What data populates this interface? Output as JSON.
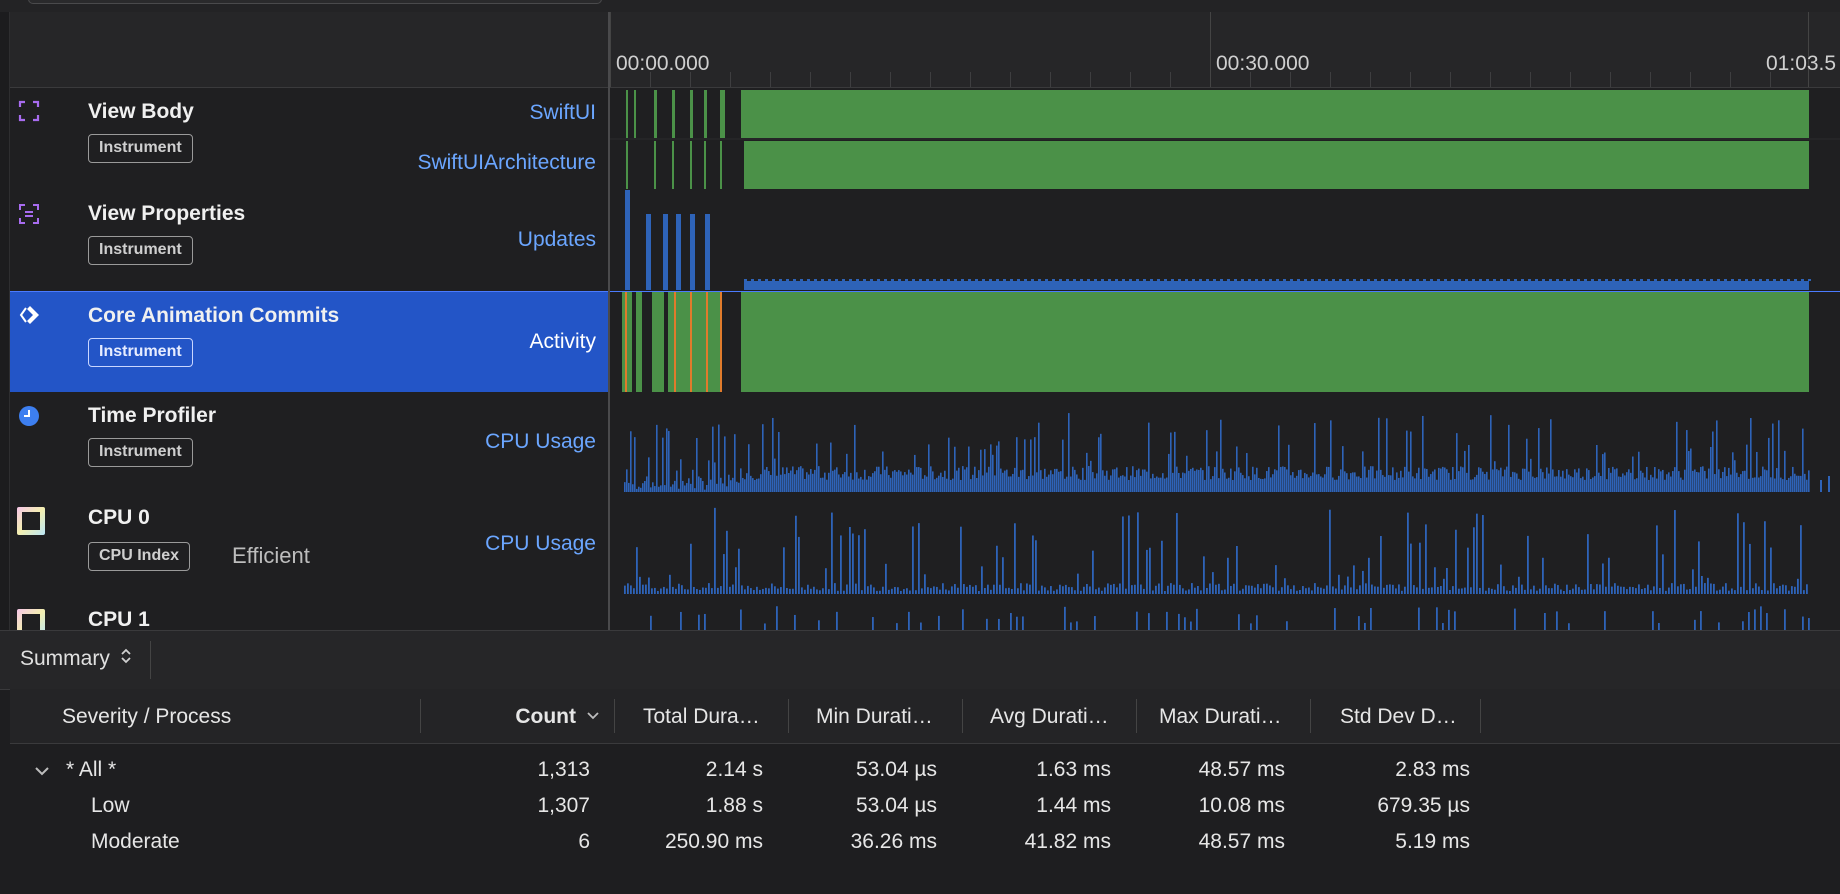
{
  "ruler": {
    "labels": [
      "00:00.000",
      "00:30.000",
      "01:03.5"
    ]
  },
  "tracks": [
    {
      "title": "View Body",
      "tag": "Instrument",
      "icon": "view-body-icon",
      "lanes": [
        "SwiftUI",
        "SwiftUIArchitecture"
      ]
    },
    {
      "title": "View Properties",
      "tag": "Instrument",
      "icon": "view-properties-icon",
      "lanes": [
        "Updates"
      ]
    },
    {
      "title": "Core Animation Commits",
      "tag": "Instrument",
      "icon": "core-animation-icon",
      "lanes": [
        "Activity"
      ],
      "selected": true
    },
    {
      "title": "Time Profiler",
      "tag": "Instrument",
      "icon": "time-profiler-icon",
      "lanes": [
        "CPU Usage"
      ]
    },
    {
      "title": "CPU 0",
      "tag": "CPU Index",
      "subtitle": "Efficient",
      "icon": "cpu-core-icon",
      "lanes": [
        "CPU Usage"
      ]
    },
    {
      "title": "CPU 1",
      "icon": "cpu-core-icon"
    }
  ],
  "summary": {
    "label": "Summary"
  },
  "table": {
    "columns": [
      "Severity / Process",
      "Count",
      "Total Dura…",
      "Min Durati…",
      "Avg Durati…",
      "Max Durati…",
      "Std Dev D…"
    ],
    "sorted_column": "Count",
    "rows": [
      {
        "name": "* All *",
        "count": "1,313",
        "total": "2.14 s",
        "min": "53.04 µs",
        "avg": "1.63 ms",
        "max": "48.57 ms",
        "std": "2.83 ms",
        "expanded": true
      },
      {
        "name": "Low",
        "count": "1,307",
        "total": "1.88 s",
        "min": "53.04 µs",
        "avg": "1.44 ms",
        "max": "10.08 ms",
        "std": "679.35 µs"
      },
      {
        "name": "Moderate",
        "count": "6",
        "total": "250.90 ms",
        "min": "36.26 ms",
        "avg": "41.82 ms",
        "max": "48.57 ms",
        "std": "5.19 ms"
      }
    ]
  },
  "colors": {
    "activity_green": "#4b9148",
    "cpu_blue": "#2e63b8",
    "selection_blue": "#2355c7",
    "link_blue": "#6ba6ff",
    "commit_orange": "#e07b2c"
  }
}
